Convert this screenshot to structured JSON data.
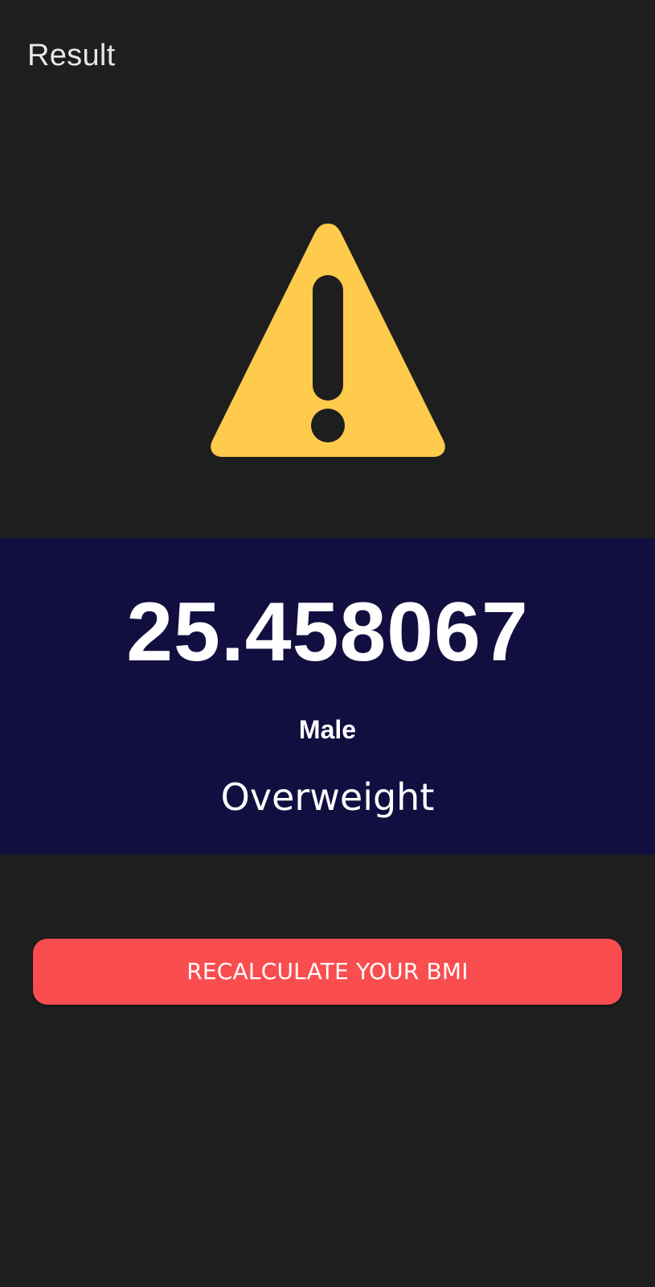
{
  "app_bar": {
    "title": "Result"
  },
  "status_icon": {
    "name": "warning-icon",
    "fill_color": "#fecb4d",
    "glyph_color": "#1e1e1e"
  },
  "result": {
    "bmi_value": "25.458067",
    "gender": "Male",
    "category": "Overweight",
    "panel_color": "#120f40"
  },
  "actions": {
    "recalculate_label": "RECALCULATE YOUR BMI",
    "recalculate_color": "#fa4d4f"
  }
}
